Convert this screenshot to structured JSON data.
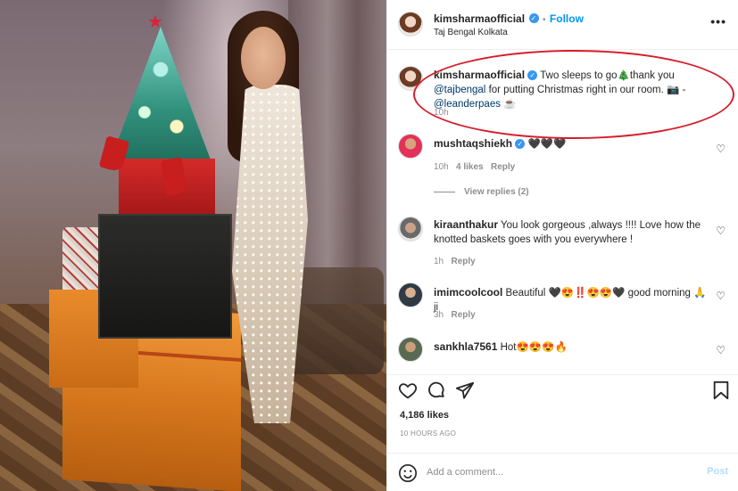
{
  "post_header": {
    "username": "kimsharmaofficial",
    "follow_label": "Follow",
    "separator": "•",
    "location": "Taj Bengal Kolkata",
    "more_label": "•••"
  },
  "caption": {
    "username": "kimsharmaofficial",
    "text_part1": "Two sleeps to go",
    "tree_glyph": "🎄",
    "text_part2": "thank you",
    "mention1": "@tajbengal",
    "text_part3": "for putting Christmas right in our room.",
    "camera_glyph": "📷",
    "text_part4": "-",
    "mention2": "@leanderpaes",
    "coffee_glyph": "☕",
    "time": "10h"
  },
  "comments": [
    {
      "username": "mushtaqshiekh",
      "verified": true,
      "text": "🖤🖤🖤",
      "time": "10h",
      "likes": "4 likes",
      "reply_label": "Reply",
      "view_replies": "View replies (2)"
    },
    {
      "username": "kiraanthakur",
      "verified": false,
      "text": "You look gorgeous ,always !!!! Love how the knotted baskets goes with you everywhere !",
      "time": "1h",
      "reply_label": "Reply"
    },
    {
      "username": "imimcoolcool",
      "verified": false,
      "text": "Beautiful 🖤😍‼️😍😍🖤 good morning 🙏 ji",
      "time": "3h",
      "reply_label": "Reply"
    },
    {
      "username": "sankhla7561",
      "verified": false,
      "text": "Hot😍😍😍🔥",
      "time": "",
      "reply_label": ""
    }
  ],
  "actions": {
    "like_icon": "heart-icon",
    "comment_icon": "comment-icon",
    "share_icon": "share-icon",
    "save_icon": "bookmark-icon"
  },
  "likes_label": "4,186 likes",
  "posted_ago": "10 HOURS AGO",
  "add_comment": {
    "placeholder": "Add a comment...",
    "post_label": "Post"
  },
  "colors": {
    "accent_blue": "#0095f6",
    "verified_blue": "#3897f0",
    "mention": "#00376b",
    "annotation_red": "#d51d2a",
    "muted": "#8e8e8e"
  }
}
